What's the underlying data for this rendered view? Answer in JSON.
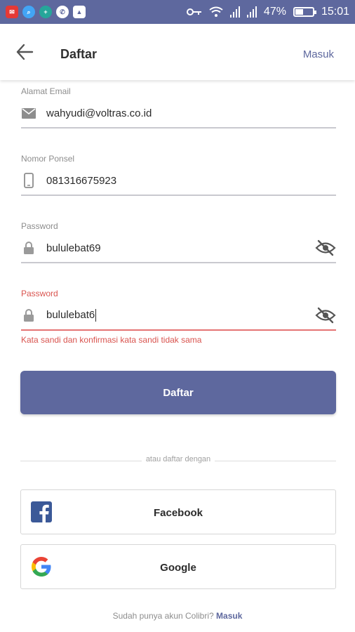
{
  "status_bar": {
    "battery": "47%",
    "battery_level": 0.47,
    "time": "15:01",
    "app_icons": [
      "notification-icon-1",
      "search-app-icon",
      "plus-circle-icon",
      "whatsapp-icon",
      "image-icon"
    ]
  },
  "appbar": {
    "title": "Daftar",
    "login_link": "Masuk"
  },
  "fields": {
    "email": {
      "label": "Alamat Email",
      "value": "wahyudi@voltras.co.id"
    },
    "phone": {
      "label": "Nomor Ponsel",
      "value": "081316675923"
    },
    "password": {
      "label": "Password",
      "value": "bululebat69"
    },
    "confirm_password": {
      "label": "Password",
      "value": "bululebat6",
      "error": "Kata sandi dan konfirmasi kata sandi tidak sama"
    }
  },
  "register_button": "Daftar",
  "divider_text": "atau daftar dengan",
  "social": {
    "facebook": "Facebook",
    "google": "Google"
  },
  "footer": {
    "prompt": "Sudah punya akun Colibri?",
    "link": "Masuk"
  },
  "colors": {
    "primary": "#5e689e",
    "error": "#d9544f"
  }
}
